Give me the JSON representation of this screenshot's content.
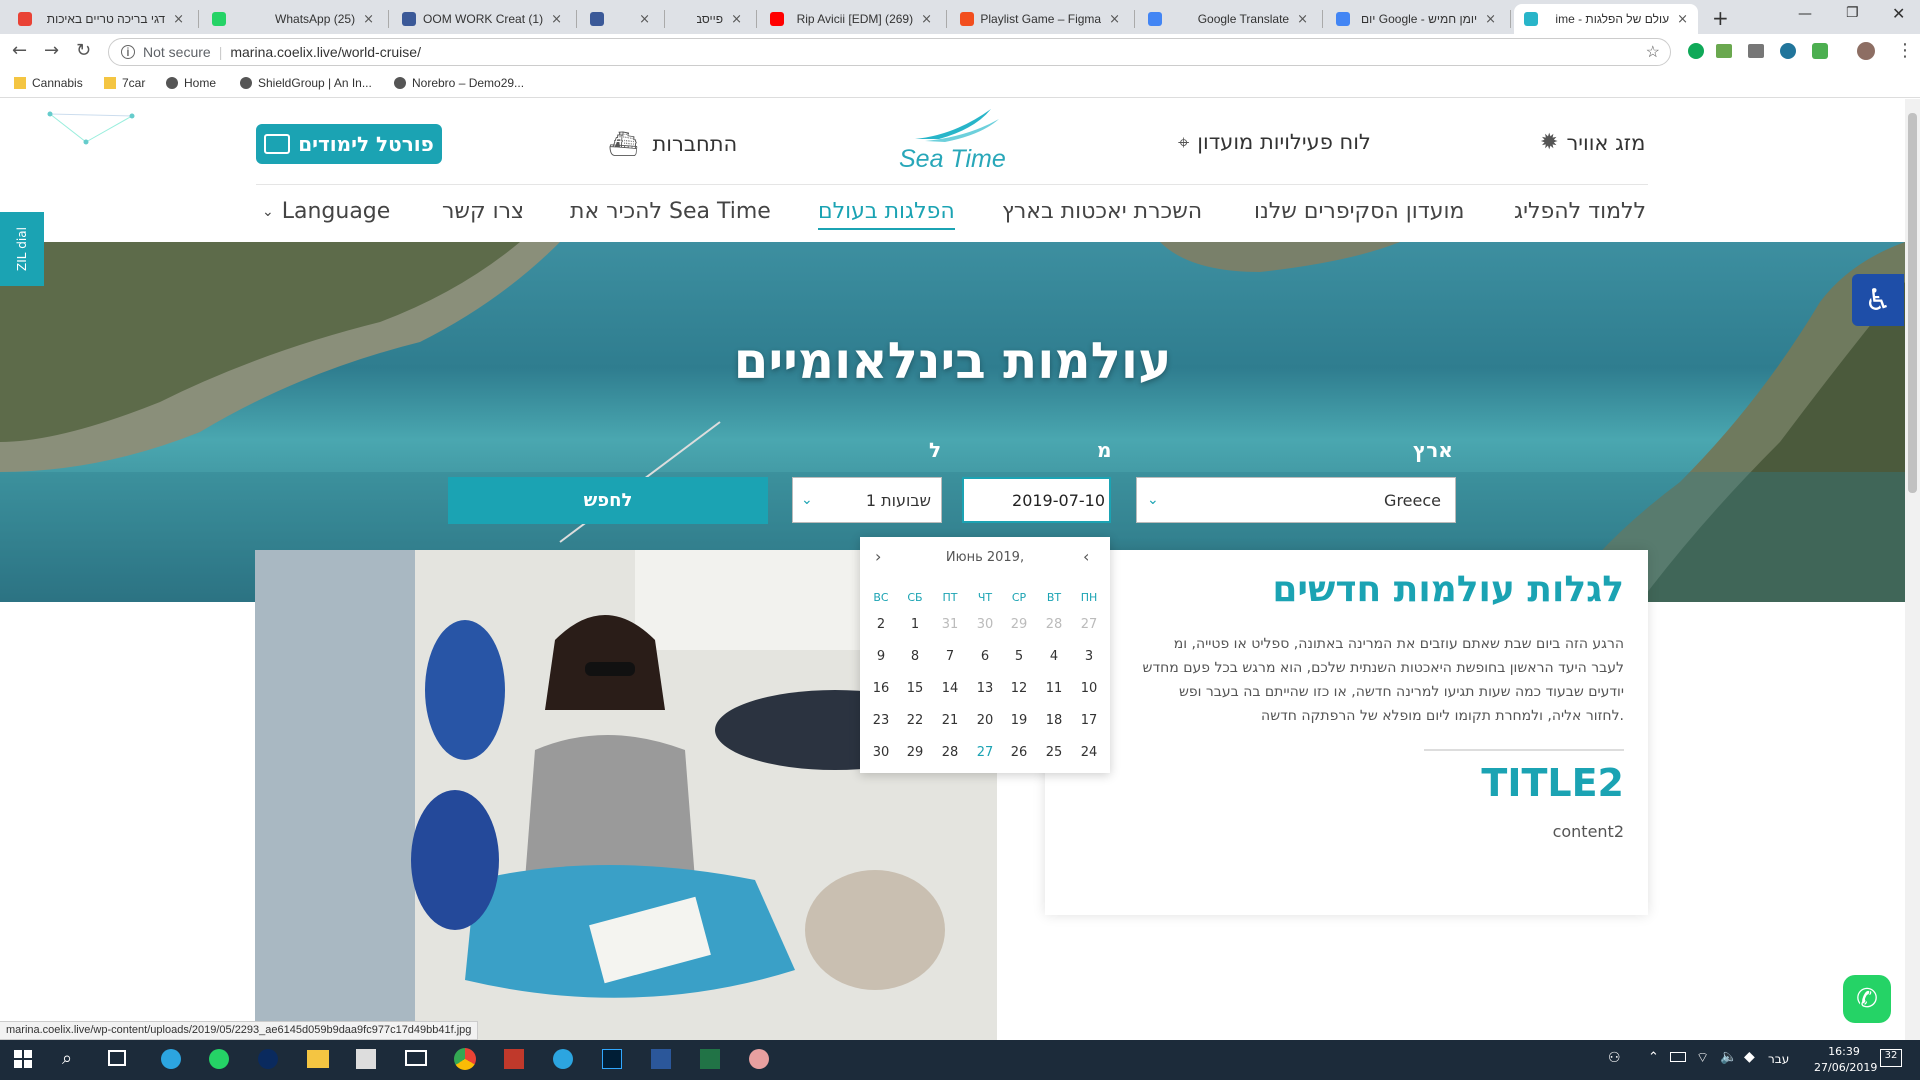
{
  "browser": {
    "tabs": [
      {
        "title": "דגי בריכה טריים באיכות",
        "color": "#e94235"
      },
      {
        "title": "(25) WhatsApp",
        "color": "#25d366"
      },
      {
        "title": "(1) ROOM WORK Creat",
        "color": "#3b5998"
      },
      {
        "title": "",
        "color": "#3b5998"
      },
      {
        "title": "פייסבוק",
        "color": "#dee1e6"
      },
      {
        "title": "(269) [EDM] Rip Avicii",
        "color": "#ff0000"
      },
      {
        "title": "Playlist Game – Figma",
        "color": "#f24e1e"
      },
      {
        "title": "Google Translate",
        "color": "#4285f4"
      },
      {
        "title": "יומן חמיש - Google יום",
        "color": "#4285f4"
      },
      {
        "title": "עולם של הפלגות - ime",
        "color": "#28b5c9"
      }
    ],
    "security": "Not secure",
    "url": "marina.coelix.live/world-cruise/",
    "bookmarks": [
      "Cannabis",
      "7car",
      "Home",
      "ShieldGroup | An In...",
      "Norebro – Demo29..."
    ],
    "status_url": "marina.coelix.live/wp-content/uploads/2019/05/2293_ae6145d059b9daa9fc977c17d49bb41f.jpg"
  },
  "site": {
    "top_links": {
      "weather": "מזג אוויר",
      "club_board": "לוח פעילויות מועדון",
      "logo": "Sea Time",
      "login": "התחברות",
      "portal": "פורטל לימודים"
    },
    "nav": [
      "ללמוד להפליג",
      "מועדון הסקיפרים שלנו",
      "השכרת יאכטות בארץ",
      "הפלגות בעולם",
      "להכיר את Sea Time",
      "צרו קשר",
      "Language"
    ],
    "side_tab": "ZIL dial",
    "hero_title": "עולמות בינלאומיים",
    "search": {
      "country_label": "ארץ",
      "from_label": "מ",
      "to_label": "ל",
      "country_value": "Greece",
      "date_value": "2019-07-10",
      "duration_value": "1 שבועות",
      "search_button": "לחפש"
    },
    "calendar": {
      "month_title": "Июнь 2019,",
      "weekdays": [
        "ПН",
        "ВТ",
        "СР",
        "ЧТ",
        "ПТ",
        "СБ",
        "ВС"
      ],
      "weeks": [
        [
          "27",
          "28",
          "29",
          "30",
          "31",
          "1",
          "2"
        ],
        [
          "3",
          "4",
          "5",
          "6",
          "7",
          "8",
          "9"
        ],
        [
          "10",
          "11",
          "12",
          "13",
          "14",
          "15",
          "16"
        ],
        [
          "17",
          "18",
          "19",
          "20",
          "21",
          "22",
          "23"
        ],
        [
          "24",
          "25",
          "26",
          "27",
          "28",
          "29",
          "30"
        ]
      ],
      "today": "27"
    },
    "content": {
      "heading": "לגלות עולמות חדשים",
      "paragraph_lines": [
        "הרגע הזה ביום שבת שאתם עוזבים את המרינה באתונה, ספליט או פטייה, ומ",
        "לעבר היעד הראשון בחופשת היאכטות השנתית שלכם, הוא מרגש בכל פעם מחדש",
        "יודעים שבעוד כמה שעות תגיעו למרינה חדשה, או כזו שהייתם בה בעבר ופש",
        "לחזור אליה, ולמחרת תקומו ליום מופלא של הרפתקה חדשה."
      ],
      "title2": "TITLE2",
      "content2": "content2"
    }
  },
  "taskbar": {
    "time": "16:39",
    "date": "27/06/2019",
    "lang": "עבר",
    "notif": "32"
  }
}
